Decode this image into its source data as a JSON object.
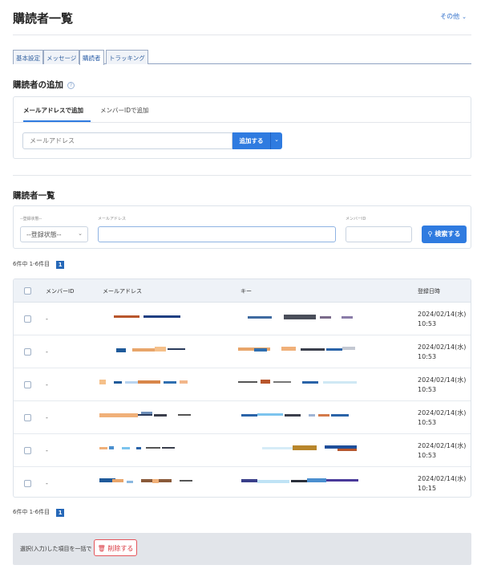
{
  "header": {
    "title": "購読者一覧",
    "other_menu": "その他"
  },
  "tabs": [
    "基本設定",
    "メッセージ",
    "購読者",
    "トラッキング"
  ],
  "add_section": {
    "title": "購読者の追加",
    "subtabs": [
      "メールアドレスで追加",
      "メンバーIDで追加"
    ],
    "email_placeholder": "メールアドレス",
    "add_button": "追加する"
  },
  "list_section": {
    "title": "購読者一覧",
    "filters": {
      "status_label": "--登録状態--",
      "status_value": "--登録状態--",
      "email_label": "メールアドレス",
      "member_label": "メンバーID",
      "search_button": "検索する"
    },
    "pager_text": "6件中 1-6件目",
    "current_page": "1",
    "columns": [
      "メンバーID",
      "メールアドレス",
      "キー",
      "登録日時"
    ],
    "rows": [
      {
        "member_id": "-",
        "date": "2024/02/14(水)",
        "time": "10:53"
      },
      {
        "member_id": "-",
        "date": "2024/02/14(水)",
        "time": "10:53"
      },
      {
        "member_id": "-",
        "date": "2024/02/14(水)",
        "time": "10:53"
      },
      {
        "member_id": "-",
        "date": "2024/02/14(水)",
        "time": "10:53"
      },
      {
        "member_id": "-",
        "date": "2024/02/14(水)",
        "time": "10:53"
      },
      {
        "member_id": "-",
        "date": "2024/02/14(水)",
        "time": "10:15"
      }
    ]
  },
  "bulk": {
    "text": "選択(入力)した項目を一括で",
    "delete_button": "削除する"
  },
  "colors": {
    "accent": "#2f7be0",
    "danger": "#d9363e",
    "page_box": "#2668b8"
  }
}
